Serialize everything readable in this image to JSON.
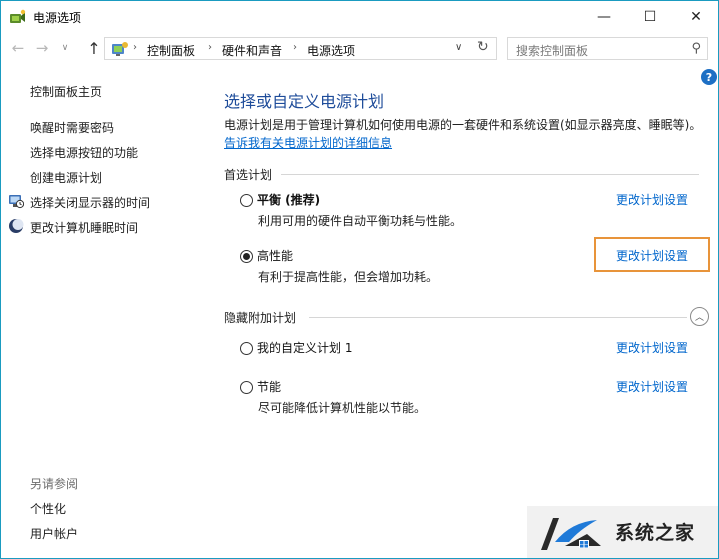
{
  "window": {
    "title": "电源选项",
    "min_glyph": "—",
    "max_glyph": "☐",
    "close_glyph": "✕"
  },
  "nav": {
    "back_glyph": "←",
    "forward_glyph": "→",
    "recent_glyph": "∨",
    "up_glyph": "↑",
    "breadcrumbs": [
      "控制面板",
      "硬件和声音",
      "电源选项"
    ],
    "crumb_sep": "›",
    "dropdown_glyph": "∨",
    "refresh_glyph": "↻"
  },
  "search": {
    "placeholder": "搜索控制面板",
    "icon_glyph": "⚲"
  },
  "sidebar": {
    "home": "控制面板主页",
    "items": [
      {
        "label": "唤醒时需要密码",
        "icon": ""
      },
      {
        "label": "选择电源按钮的功能",
        "icon": ""
      },
      {
        "label": "创建电源计划",
        "icon": ""
      },
      {
        "label": "选择关闭显示器的时间",
        "icon": "monitor-clock-icon"
      },
      {
        "label": "更改计算机睡眠时间",
        "icon": "moon-icon"
      }
    ],
    "see_also_title": "另请参阅",
    "see_also": [
      "个性化",
      "用户帐户"
    ]
  },
  "main": {
    "title": "选择或自定义电源计划",
    "description": "电源计划是用于管理计算机如何使用电源的一套硬件和系统设置(如显示器亮度、睡眠等)。",
    "info_link": "告诉我有关电源计划的详细信息",
    "preferred_header": "首选计划",
    "hidden_header": "隐藏附加计划",
    "collapse_glyph": "︿",
    "help_glyph": "?",
    "plans": [
      {
        "name": "平衡 (推荐)",
        "desc": "利用可用的硬件自动平衡功耗与性能。",
        "selected": false,
        "link": "更改计划设置"
      },
      {
        "name": "高性能",
        "desc": "有利于提高性能，但会增加功耗。",
        "selected": true,
        "link": "更改计划设置",
        "highlighted": true
      },
      {
        "name": "我的自定义计划 1",
        "desc": "",
        "selected": false,
        "link": "更改计划设置"
      },
      {
        "name": "节能",
        "desc": "尽可能降低计算机性能以节能。",
        "selected": false,
        "link": "更改计划设置"
      }
    ]
  },
  "watermark": {
    "text": "系统之家"
  },
  "colors": {
    "accent_link": "#0066cc",
    "title_blue": "#1e4c9a",
    "highlight": "#e8943a",
    "window_border": "#1a9bc0"
  }
}
